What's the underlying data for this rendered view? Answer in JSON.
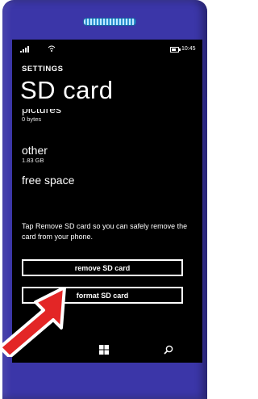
{
  "statusbar": {
    "time": "10:45"
  },
  "header": {
    "section": "SETTINGS",
    "title": "SD card"
  },
  "storage": {
    "partial_item": {
      "name": "pictures",
      "size": "0 bytes"
    },
    "items": [
      {
        "name": "other",
        "size": "1.83 GB"
      },
      {
        "name": "free space"
      }
    ]
  },
  "info": {
    "text": "Tap Remove SD card so you can safely remove the card from your phone."
  },
  "buttons": {
    "remove_label": "remove SD card",
    "format_label": "format SD card"
  },
  "navbar": {
    "back_icon": "back-arrow-icon",
    "start_icon": "windows-logo-icon",
    "search_icon": "search-icon"
  },
  "colors": {
    "phone_body": "#3b36a8",
    "screen": "#000000",
    "arrow": "#e32626"
  }
}
